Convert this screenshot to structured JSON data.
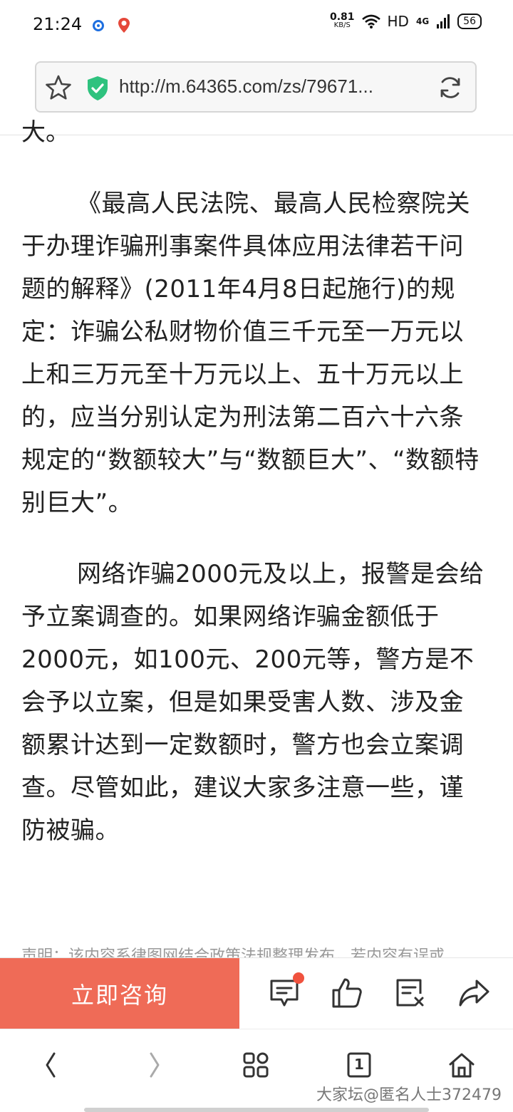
{
  "status_bar": {
    "time": "21:24",
    "net_speed_value": "0.81",
    "net_speed_unit": "KB/S",
    "hd": "HD",
    "network": "4G",
    "battery": "56"
  },
  "address_bar": {
    "url": "http://m.64365.com/zs/79671..."
  },
  "article": {
    "partial_top": "大。",
    "paragraph_1": "《最高人民法院、最高人民检察院关于办理诈骗刑事案件具体应用法律若干问题的解释》(2011年4月8日起施行)的规定：诈骗公私财物价值三千元至一万元以上和三万元至十万元以上、五十万元以上的，应当分别认定为刑法第二百六十六条规定的“数额较大”与“数额巨大”、“数额特别巨大”。",
    "paragraph_2": "网络诈骗2000元及以上，报警是会给予立案调查的。如果网络诈骗金额低于2000元，如100元、200元等，警方是不会予以立案，但是如果受害人数、涉及金额累计达到一定数额时，警方也会立案调查。尽管如此，建议大家多注意一些，谨防被骗。",
    "disclaimer": "声明：该内容系律图网结合政策法规整理发布，若内容有误或"
  },
  "action_bar": {
    "consult_label": "立即咨询"
  },
  "bottom_nav": {
    "tabs_count": "1"
  },
  "watermark": "大家坛@匿名人士372479",
  "colors": {
    "accent": "#ef6b57",
    "shield": "#2ec27e",
    "notification_dot": "#f0523e"
  }
}
